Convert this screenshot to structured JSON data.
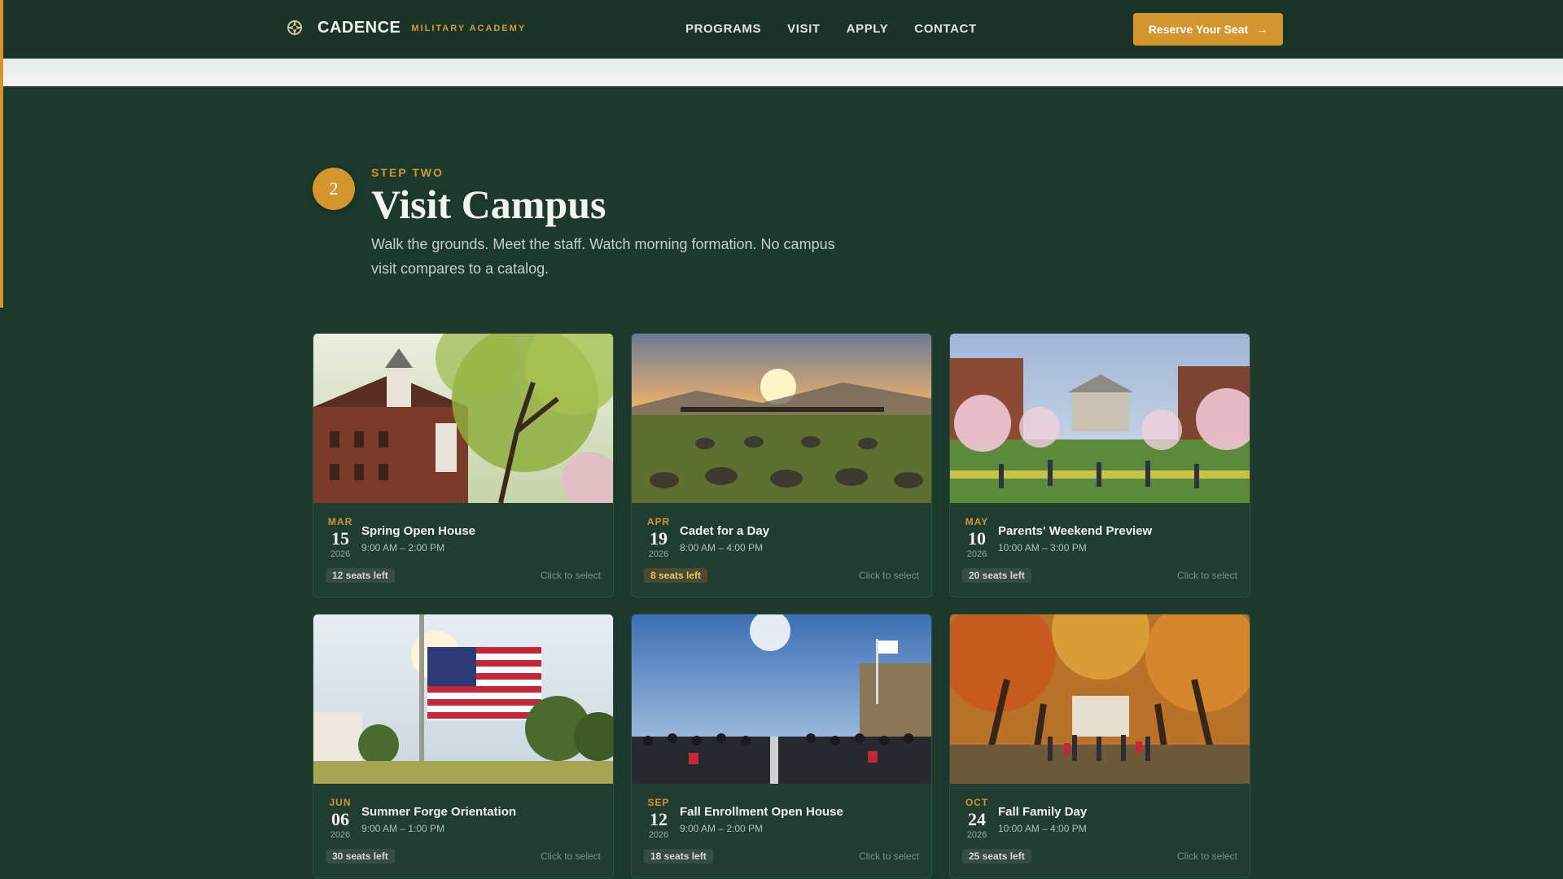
{
  "nav": {
    "brand_name": "CADENCE",
    "brand_sub": "MILITARY ACADEMY",
    "links": [
      "PROGRAMS",
      "VISIT",
      "APPLY",
      "CONTACT"
    ],
    "cta_label": "Reserve Your Seat"
  },
  "section": {
    "step_number": "2",
    "step_label": "STEP TWO",
    "title": "Visit Campus",
    "description": "Walk the grounds. Meet the staff. Watch morning formation. No campus visit compares to a catalog."
  },
  "events": [
    {
      "month": "MAR",
      "day": "15",
      "year": "2026",
      "title": "Spring Open House",
      "time": "9:00 AM – 2:00 PM",
      "seats": "12 seats left",
      "action": "Click to select",
      "image": "brick-hall-spring-trees"
    },
    {
      "month": "APR",
      "day": "19",
      "year": "2026",
      "title": "Cadet for a Day",
      "time": "8:00 AM – 4:00 PM",
      "seats": "8 seats left",
      "action": "Click to select",
      "image": "cadets-sunrise-field"
    },
    {
      "month": "MAY",
      "day": "10",
      "year": "2026",
      "title": "Parents' Weekend Preview",
      "time": "10:00 AM – 3:00 PM",
      "seats": "20 seats left",
      "action": "Click to select",
      "image": "campus-quad-blossoms"
    },
    {
      "month": "JUN",
      "day": "06",
      "year": "2026",
      "title": "Summer Forge Orientation",
      "time": "9:00 AM – 1:00 PM",
      "seats": "30 seats left",
      "action": "Click to select",
      "image": "american-flag-sunlight"
    },
    {
      "month": "SEP",
      "day": "12",
      "year": "2026",
      "title": "Fall Enrollment Open House",
      "time": "9:00 AM – 2:00 PM",
      "seats": "18 seats left",
      "action": "Click to select",
      "image": "crowd-formation-campus"
    },
    {
      "month": "OCT",
      "day": "24",
      "year": "2026",
      "title": "Fall Family Day",
      "time": "10:00 AM – 4:00 PM",
      "seats": "25 seats left",
      "action": "Click to select",
      "image": "autumn-tree-avenue"
    }
  ],
  "colors": {
    "background": "#1b3a2d",
    "accent": "#d4952f",
    "card": "#1f3d30"
  }
}
